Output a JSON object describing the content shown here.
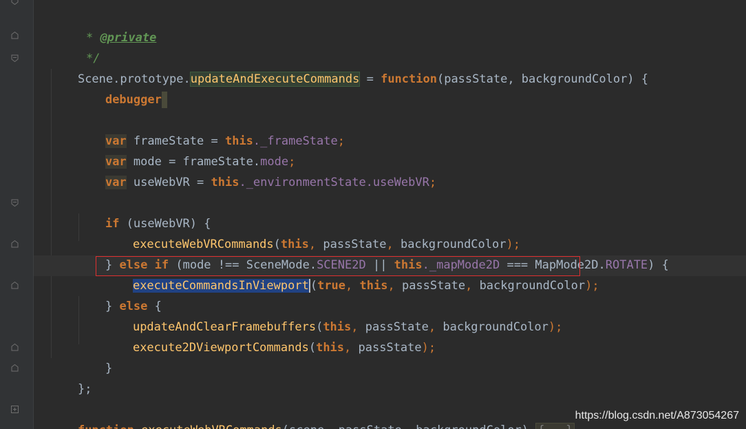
{
  "code": {
    "l1": {
      "text": "@private"
    },
    "l2": {
      "text": "*/"
    },
    "l3": {
      "obj": "Scene.prototype.",
      "name": "updateAndExecuteCommands",
      "assign": " = ",
      "fn": "function",
      "params": "(passState, backgroundColor) {"
    },
    "l4": {
      "text": "debugger"
    },
    "l5": {
      "kw": "var",
      "name": " frameState = ",
      "this": "this",
      "rest": "._frameState",
      "semi": ";"
    },
    "l6": {
      "kw": "var",
      "name": " mode = frameState.",
      "prop": "mode",
      "semi": ";"
    },
    "l7": {
      "kw": "var",
      "name": " useWebVR = ",
      "this": "this",
      "rest": "._environmentState.",
      "prop": "useWebVR",
      "semi": ";"
    },
    "l8": {
      "kw": "if",
      "rest": " (useWebVR) {"
    },
    "l9": {
      "fn": "executeWebVRCommands",
      "open": "(",
      "this": "this",
      "c1": ", ",
      "a": "passState",
      "c2": ", ",
      "b": "backgroundColor",
      "close": ");"
    },
    "l10": {
      "brace": "} ",
      "else": "else",
      "sp": " ",
      "if": "if",
      "p1": " (mode !== SceneMode.",
      "scene2d": "SCENE2D",
      "or": " || ",
      "this": "this",
      "map": "._mapMode2D",
      "eq": " === MapMode2D.",
      "rotate": "ROTATE",
      "p2": ") {"
    },
    "l11": {
      "fn": "executeCommandsInViewport",
      "open": "(",
      "true": "true",
      "c1": ", ",
      "this": "this",
      "c2": ", ",
      "a": "passState",
      "c3": ", ",
      "b": "backgroundColor",
      "close": ");"
    },
    "l12": {
      "brace": "} ",
      "else": "else",
      "rest": " {"
    },
    "l13": {
      "fn": "updateAndClearFramebuffers",
      "open": "(",
      "this": "this",
      "c1": ", ",
      "a": "passState",
      "c2": ", ",
      "b": "backgroundColor",
      "close": ");"
    },
    "l14": {
      "fn": "execute2DViewportCommands",
      "open": "(",
      "this": "this",
      "c1": ", ",
      "a": "passState",
      "close": ");"
    },
    "l15": {
      "text": "}"
    },
    "l16": {
      "text": "};"
    },
    "l17": {
      "fn": "function",
      "name": "executeWebVRCommands",
      "params": "(scene, passState, backgroundColor) ",
      "folded": "{...}"
    }
  },
  "doc_star": "* ",
  "watermark": "https://blog.csdn.net/A873054267"
}
